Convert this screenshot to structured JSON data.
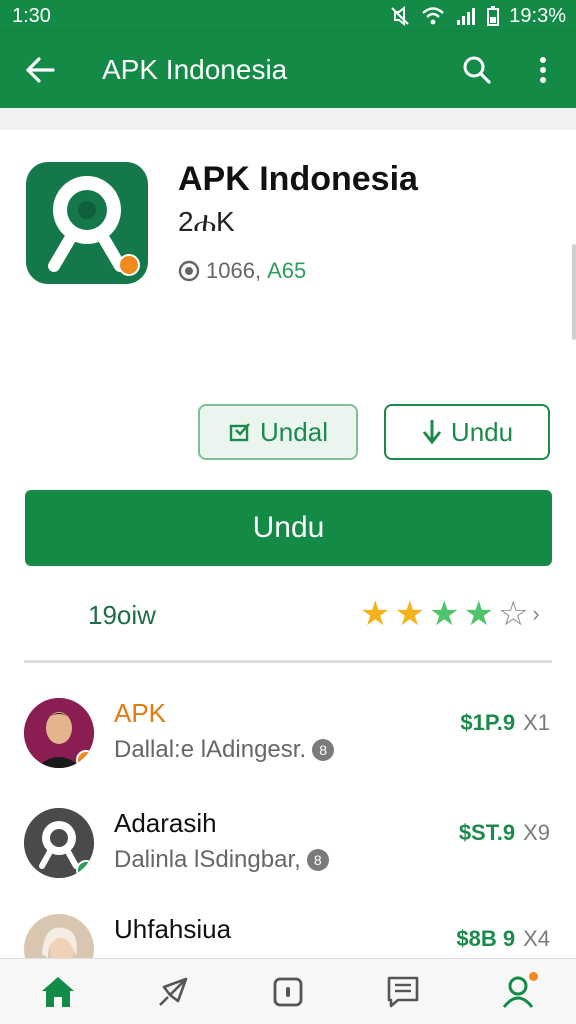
{
  "status_bar": {
    "time": "1:30",
    "battery": "19:3%"
  },
  "app_bar": {
    "title": "APK Indonesia"
  },
  "app": {
    "name": "APK Indonesia",
    "size": "2ሐK",
    "downloads_prefix": "1066,",
    "downloads_suffix": "A65"
  },
  "buttons": {
    "secondary_1": "Undal",
    "secondary_2": "Undu",
    "primary": "Undu"
  },
  "rating": {
    "count": "19oiw",
    "stars_filled": 4,
    "stars_total": 5
  },
  "list": [
    {
      "title": "APK",
      "subtitle": "Dallal:e lAdingesr.",
      "price": "$1P.9",
      "multiplier": "X1",
      "title_color": "#e07a12"
    },
    {
      "title": "Adarasih",
      "subtitle": "Dalinla lSdingbar,",
      "price": "$ST.9",
      "multiplier": "X9",
      "title_color": "#111111"
    },
    {
      "title": "Uhfahsiua",
      "subtitle": "",
      "price": "$8B 9",
      "multiplier": "X4",
      "title_color": "#111111"
    }
  ],
  "colors": {
    "primary": "#138a45",
    "accent_orange": "#f08a1c",
    "star_yellow": "#f5b21b",
    "star_green": "#4fc46a"
  },
  "icons": [
    "back-arrow-icon",
    "search-icon",
    "more-vert-icon",
    "home-icon",
    "rocket-icon",
    "square-icon",
    "chat-icon",
    "person-icon"
  ]
}
